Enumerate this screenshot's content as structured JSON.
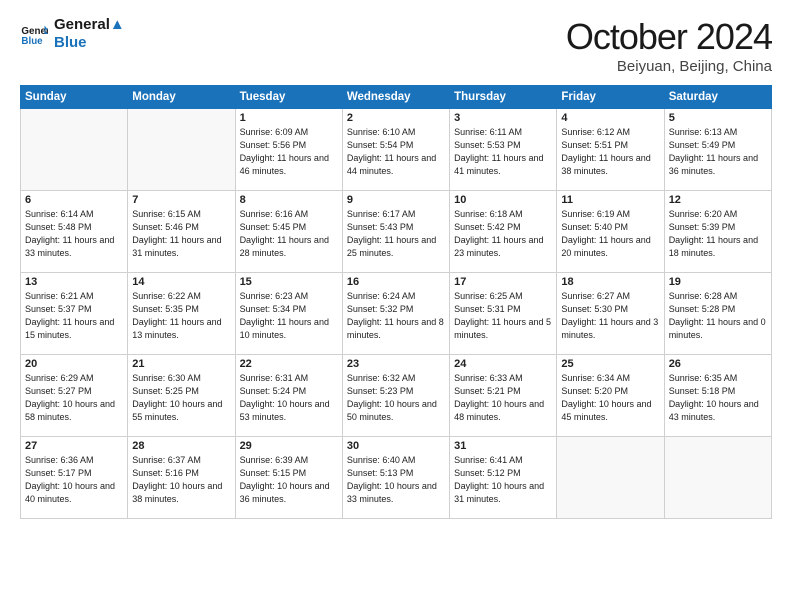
{
  "header": {
    "logo_line1": "General",
    "logo_line2": "Blue",
    "month": "October 2024",
    "location": "Beiyuan, Beijing, China"
  },
  "weekdays": [
    "Sunday",
    "Monday",
    "Tuesday",
    "Wednesday",
    "Thursday",
    "Friday",
    "Saturday"
  ],
  "weeks": [
    [
      {
        "day": "",
        "info": ""
      },
      {
        "day": "",
        "info": ""
      },
      {
        "day": "1",
        "info": "Sunrise: 6:09 AM\nSunset: 5:56 PM\nDaylight: 11 hours and 46 minutes."
      },
      {
        "day": "2",
        "info": "Sunrise: 6:10 AM\nSunset: 5:54 PM\nDaylight: 11 hours and 44 minutes."
      },
      {
        "day": "3",
        "info": "Sunrise: 6:11 AM\nSunset: 5:53 PM\nDaylight: 11 hours and 41 minutes."
      },
      {
        "day": "4",
        "info": "Sunrise: 6:12 AM\nSunset: 5:51 PM\nDaylight: 11 hours and 38 minutes."
      },
      {
        "day": "5",
        "info": "Sunrise: 6:13 AM\nSunset: 5:49 PM\nDaylight: 11 hours and 36 minutes."
      }
    ],
    [
      {
        "day": "6",
        "info": "Sunrise: 6:14 AM\nSunset: 5:48 PM\nDaylight: 11 hours and 33 minutes."
      },
      {
        "day": "7",
        "info": "Sunrise: 6:15 AM\nSunset: 5:46 PM\nDaylight: 11 hours and 31 minutes."
      },
      {
        "day": "8",
        "info": "Sunrise: 6:16 AM\nSunset: 5:45 PM\nDaylight: 11 hours and 28 minutes."
      },
      {
        "day": "9",
        "info": "Sunrise: 6:17 AM\nSunset: 5:43 PM\nDaylight: 11 hours and 25 minutes."
      },
      {
        "day": "10",
        "info": "Sunrise: 6:18 AM\nSunset: 5:42 PM\nDaylight: 11 hours and 23 minutes."
      },
      {
        "day": "11",
        "info": "Sunrise: 6:19 AM\nSunset: 5:40 PM\nDaylight: 11 hours and 20 minutes."
      },
      {
        "day": "12",
        "info": "Sunrise: 6:20 AM\nSunset: 5:39 PM\nDaylight: 11 hours and 18 minutes."
      }
    ],
    [
      {
        "day": "13",
        "info": "Sunrise: 6:21 AM\nSunset: 5:37 PM\nDaylight: 11 hours and 15 minutes."
      },
      {
        "day": "14",
        "info": "Sunrise: 6:22 AM\nSunset: 5:35 PM\nDaylight: 11 hours and 13 minutes."
      },
      {
        "day": "15",
        "info": "Sunrise: 6:23 AM\nSunset: 5:34 PM\nDaylight: 11 hours and 10 minutes."
      },
      {
        "day": "16",
        "info": "Sunrise: 6:24 AM\nSunset: 5:32 PM\nDaylight: 11 hours and 8 minutes."
      },
      {
        "day": "17",
        "info": "Sunrise: 6:25 AM\nSunset: 5:31 PM\nDaylight: 11 hours and 5 minutes."
      },
      {
        "day": "18",
        "info": "Sunrise: 6:27 AM\nSunset: 5:30 PM\nDaylight: 11 hours and 3 minutes."
      },
      {
        "day": "19",
        "info": "Sunrise: 6:28 AM\nSunset: 5:28 PM\nDaylight: 11 hours and 0 minutes."
      }
    ],
    [
      {
        "day": "20",
        "info": "Sunrise: 6:29 AM\nSunset: 5:27 PM\nDaylight: 10 hours and 58 minutes."
      },
      {
        "day": "21",
        "info": "Sunrise: 6:30 AM\nSunset: 5:25 PM\nDaylight: 10 hours and 55 minutes."
      },
      {
        "day": "22",
        "info": "Sunrise: 6:31 AM\nSunset: 5:24 PM\nDaylight: 10 hours and 53 minutes."
      },
      {
        "day": "23",
        "info": "Sunrise: 6:32 AM\nSunset: 5:23 PM\nDaylight: 10 hours and 50 minutes."
      },
      {
        "day": "24",
        "info": "Sunrise: 6:33 AM\nSunset: 5:21 PM\nDaylight: 10 hours and 48 minutes."
      },
      {
        "day": "25",
        "info": "Sunrise: 6:34 AM\nSunset: 5:20 PM\nDaylight: 10 hours and 45 minutes."
      },
      {
        "day": "26",
        "info": "Sunrise: 6:35 AM\nSunset: 5:18 PM\nDaylight: 10 hours and 43 minutes."
      }
    ],
    [
      {
        "day": "27",
        "info": "Sunrise: 6:36 AM\nSunset: 5:17 PM\nDaylight: 10 hours and 40 minutes."
      },
      {
        "day": "28",
        "info": "Sunrise: 6:37 AM\nSunset: 5:16 PM\nDaylight: 10 hours and 38 minutes."
      },
      {
        "day": "29",
        "info": "Sunrise: 6:39 AM\nSunset: 5:15 PM\nDaylight: 10 hours and 36 minutes."
      },
      {
        "day": "30",
        "info": "Sunrise: 6:40 AM\nSunset: 5:13 PM\nDaylight: 10 hours and 33 minutes."
      },
      {
        "day": "31",
        "info": "Sunrise: 6:41 AM\nSunset: 5:12 PM\nDaylight: 10 hours and 31 minutes."
      },
      {
        "day": "",
        "info": ""
      },
      {
        "day": "",
        "info": ""
      }
    ]
  ]
}
